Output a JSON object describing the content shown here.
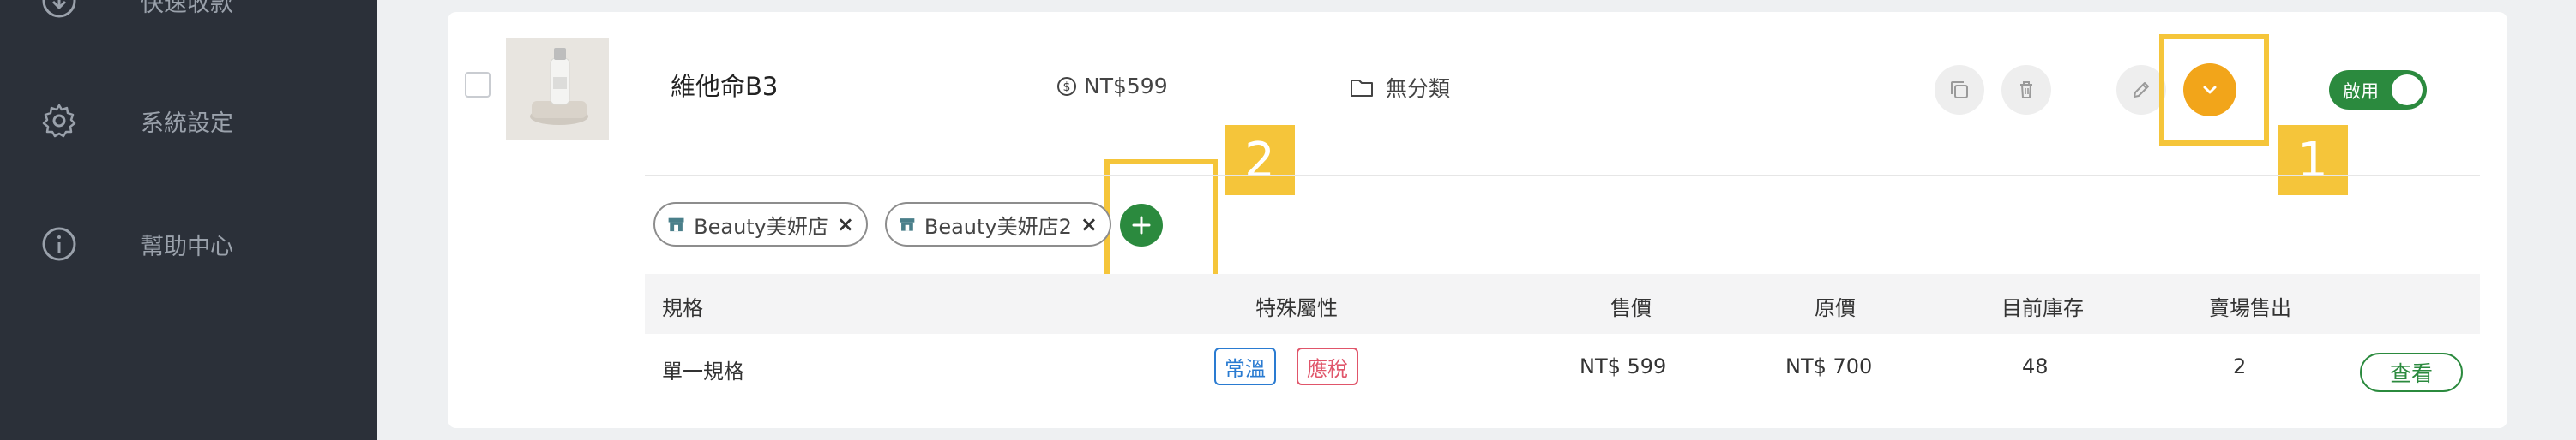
{
  "sidebar": {
    "items": [
      {
        "label": "快速收款",
        "icon": "download-circle-icon"
      },
      {
        "label": "系統設定",
        "icon": "gear-icon"
      },
      {
        "label": "幫助中心",
        "icon": "info-circle-icon"
      }
    ]
  },
  "product": {
    "name": "維他命B3",
    "price": "NT$599",
    "category": "無分類",
    "status_label": "啟用"
  },
  "stores": [
    "Beauty美妍店",
    "Beauty美妍店2"
  ],
  "annotations": [
    "1",
    "2"
  ],
  "table": {
    "headers": [
      "規格",
      "特殊屬性",
      "售價",
      "原價",
      "目前庫存",
      "賣場售出"
    ],
    "row": {
      "spec": "單一規格",
      "attrs": [
        "常溫",
        "應稅"
      ],
      "price": "NT$ 599",
      "original_price": "NT$ 700",
      "stock": "48",
      "sold": "2",
      "action": "查看"
    }
  },
  "colors": {
    "sidebar_bg": "#2b3039",
    "accent_orange": "#f2a51a",
    "accent_green": "#2b8a3e",
    "highlight_yellow": "#f5c53a",
    "tag_blue": "#2a7bd1",
    "tag_red": "#e0556a"
  }
}
